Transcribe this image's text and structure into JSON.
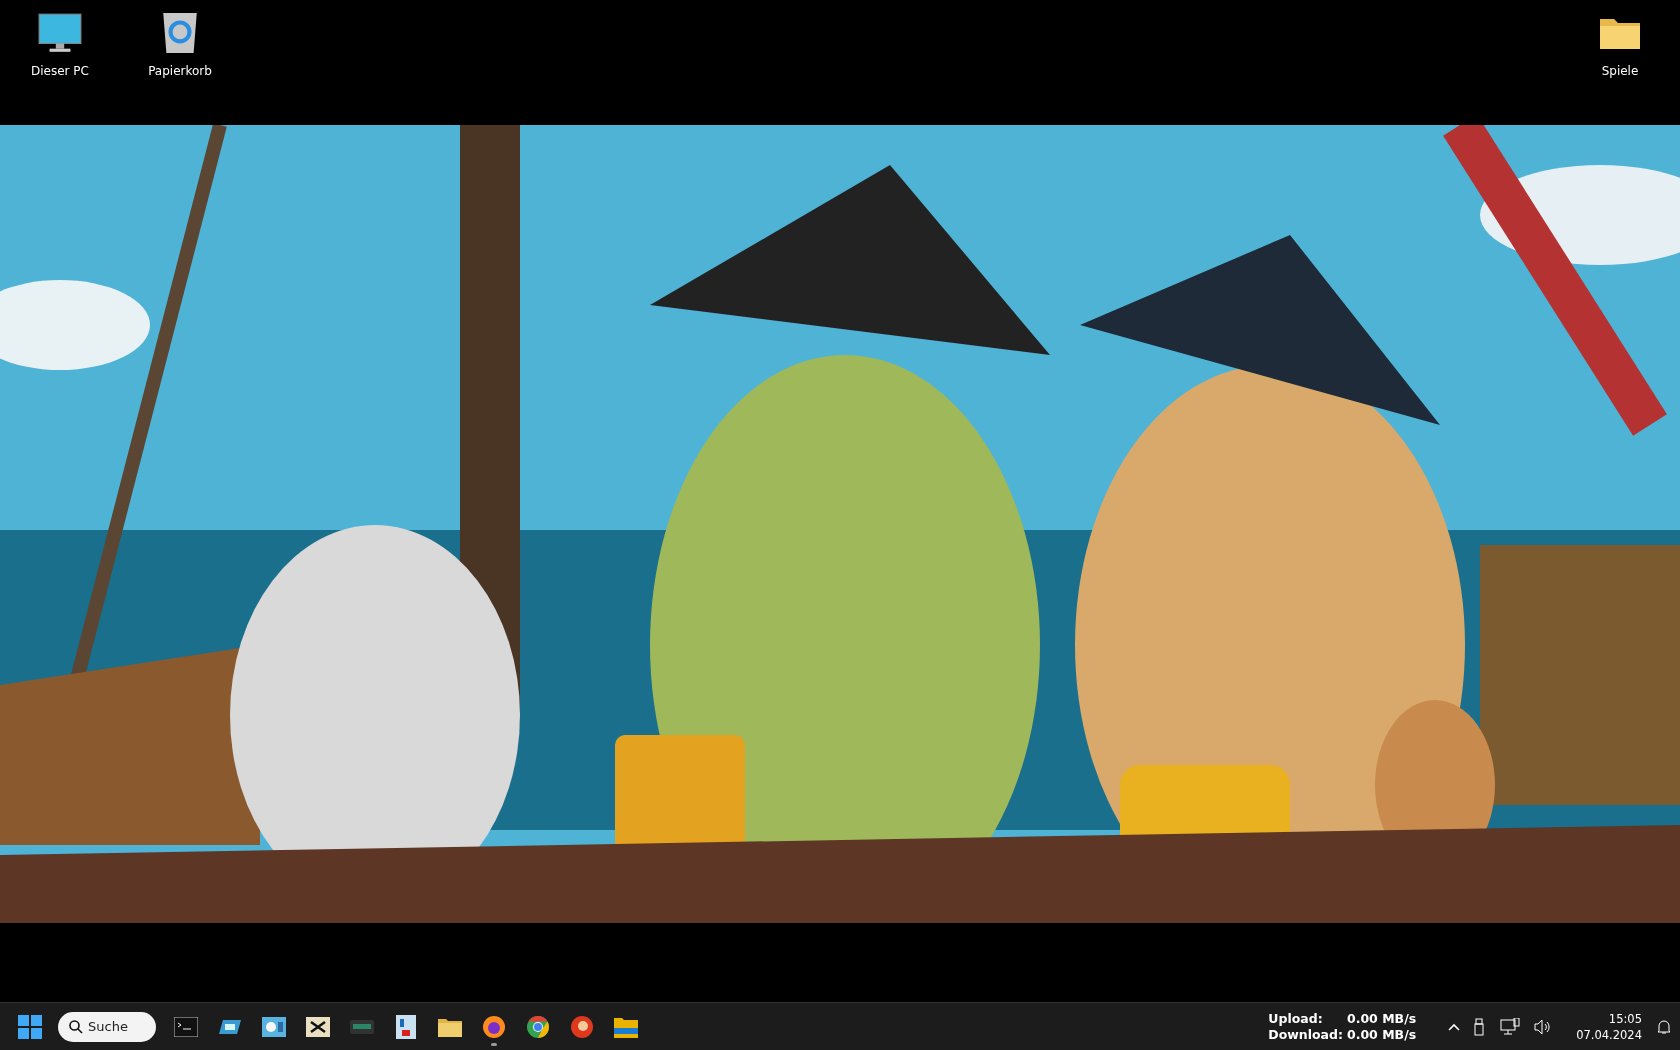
{
  "desktop_icons": [
    {
      "kind": "monitor",
      "label": "Dieser PC"
    },
    {
      "kind": "trash",
      "label": "Papierkorb"
    },
    {
      "kind": "folder",
      "label": "Spiele"
    }
  ],
  "taskbar": {
    "search": {
      "placeholder": "Suche"
    },
    "apps": [
      {
        "kind": "terminal",
        "running": false
      },
      {
        "kind": "drive",
        "running": false
      },
      {
        "kind": "monitor",
        "running": false
      },
      {
        "kind": "hex",
        "running": false
      },
      {
        "kind": "ssd",
        "running": false
      },
      {
        "kind": "id",
        "running": false
      },
      {
        "kind": "folder",
        "running": false
      },
      {
        "kind": "firefox",
        "running": true
      },
      {
        "kind": "chrome",
        "running": false
      },
      {
        "kind": "red",
        "running": false
      },
      {
        "kind": "explorer",
        "running": false
      }
    ],
    "network": {
      "upload_label": "Upload:",
      "upload_value": "0.00 MB/s",
      "download_label": "Download:",
      "download_value": "0.00 MB/s"
    },
    "time": "15:05",
    "date": "07.04.2024"
  }
}
